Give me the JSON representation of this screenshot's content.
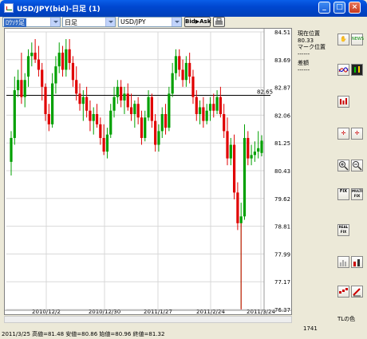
{
  "window": {
    "title": "USD/JPY(bid)-日足 (1)"
  },
  "toolbar": {
    "chart_type": "ﾛｳｿｸ足",
    "period": "日足",
    "symbol": "USD/JPY",
    "bid_ask_label": "Bid▶Ask"
  },
  "info_panel": {
    "current_pos_label": "現在位置",
    "current_pos_value": "80.33",
    "mark_pos_label": "マーク位置",
    "mark_pos_value": "------",
    "diff_label": "差額",
    "diff_value": "------"
  },
  "tools": {
    "news": "NEWS",
    "fix": "FIX",
    "multi_fix": "MULTI FIX",
    "real_fix": "REAL FIX"
  },
  "status": {
    "text": "2011/3/25  高値=81.48 安値=80.86 始値=80.96 終値=81.32",
    "tl_color": "TLの色",
    "count": "1741"
  },
  "colors": {
    "up": "#00a000",
    "down": "#e00000",
    "accent": "#0047d0"
  },
  "chart_data": {
    "type": "candlestick",
    "price_axis": [
      "84.51",
      "83.69",
      "82.87",
      "82.06",
      "81.25",
      "80.43",
      "79.62",
      "78.81",
      "77.99",
      "77.17",
      "76.37"
    ],
    "date_axis": [
      "2010/12/2",
      "2010/12/30",
      "2011/1/27",
      "2011/2/24",
      "2011/3/24"
    ],
    "ylim": [
      76.37,
      84.51
    ],
    "level_line": "82.65",
    "candles": [
      [
        80.7,
        81.6,
        80.3,
        81.4
      ],
      [
        81.4,
        83.2,
        81.2,
        82.8
      ],
      [
        82.8,
        83.4,
        82.6,
        83.1
      ],
      [
        83.1,
        83.9,
        82.4,
        82.6
      ],
      [
        82.6,
        83.3,
        82.3,
        83.1
      ],
      [
        83.2,
        84.0,
        82.9,
        83.8
      ],
      [
        83.8,
        84.2,
        83.5,
        83.9
      ],
      [
        83.9,
        84.3,
        83.6,
        83.7
      ],
      [
        83.7,
        84.1,
        83.2,
        83.4
      ],
      [
        83.4,
        83.6,
        82.5,
        82.9
      ],
      [
        82.9,
        83.0,
        81.9,
        82.1
      ],
      [
        82.1,
        82.4,
        81.6,
        81.8
      ],
      [
        81.8,
        83.3,
        81.7,
        83.0
      ],
      [
        83.0,
        83.8,
        82.7,
        83.5
      ],
      [
        83.5,
        84.2,
        83.3,
        83.9
      ],
      [
        83.9,
        84.1,
        83.2,
        83.4
      ],
      [
        83.4,
        84.3,
        83.2,
        84.0
      ],
      [
        84.0,
        84.3,
        83.4,
        83.6
      ],
      [
        83.6,
        83.8,
        82.9,
        83.1
      ],
      [
        83.1,
        83.5,
        82.5,
        82.7
      ],
      [
        82.7,
        83.0,
        82.2,
        82.4
      ],
      [
        82.4,
        82.8,
        81.9,
        82.6
      ],
      [
        82.6,
        82.9,
        82.0,
        82.2
      ],
      [
        82.2,
        82.5,
        81.6,
        81.9
      ],
      [
        81.9,
        82.3,
        81.5,
        82.1
      ],
      [
        82.1,
        82.4,
        81.7,
        81.8
      ],
      [
        81.8,
        82.0,
        81.2,
        81.4
      ],
      [
        81.4,
        81.8,
        80.9,
        81.0
      ],
      [
        81.0,
        81.7,
        80.8,
        81.5
      ],
      [
        81.5,
        82.4,
        81.4,
        82.2
      ],
      [
        82.2,
        82.9,
        82.0,
        82.6
      ],
      [
        82.6,
        83.1,
        82.4,
        82.9
      ],
      [
        82.9,
        83.1,
        82.3,
        82.5
      ],
      [
        82.5,
        82.9,
        82.1,
        82.7
      ],
      [
        82.7,
        83.0,
        82.2,
        82.3
      ],
      [
        82.3,
        82.7,
        81.9,
        82.1
      ],
      [
        82.1,
        82.5,
        81.7,
        82.4
      ],
      [
        82.4,
        82.6,
        81.8,
        82.0
      ],
      [
        82.0,
        82.2,
        81.2,
        81.4
      ],
      [
        81.4,
        82.2,
        81.3,
        82.0
      ],
      [
        82.0,
        82.8,
        81.9,
        82.6
      ],
      [
        82.6,
        82.7,
        81.7,
        81.9
      ],
      [
        81.9,
        82.1,
        81.0,
        81.2
      ],
      [
        81.2,
        81.8,
        81.0,
        81.6
      ],
      [
        81.6,
        82.3,
        81.4,
        82.1
      ],
      [
        82.1,
        82.4,
        81.5,
        81.7
      ],
      [
        81.7,
        82.9,
        81.6,
        82.7
      ],
      [
        82.7,
        83.6,
        82.6,
        83.3
      ],
      [
        83.3,
        84.0,
        83.1,
        83.8
      ],
      [
        83.8,
        84.0,
        83.2,
        83.4
      ],
      [
        83.4,
        83.7,
        82.9,
        83.1
      ],
      [
        83.1,
        83.8,
        82.9,
        83.6
      ],
      [
        83.6,
        83.9,
        83.0,
        83.2
      ],
      [
        83.2,
        83.4,
        82.4,
        82.6
      ],
      [
        82.6,
        82.8,
        81.9,
        82.1
      ],
      [
        82.1,
        82.5,
        81.8,
        82.3
      ],
      [
        82.3,
        82.6,
        81.7,
        81.9
      ],
      [
        81.9,
        82.4,
        81.8,
        82.2
      ],
      [
        82.2,
        82.6,
        81.9,
        82.4
      ],
      [
        82.4,
        82.7,
        82.0,
        82.2
      ],
      [
        82.2,
        82.8,
        82.1,
        82.6
      ],
      [
        82.6,
        82.9,
        82.0,
        82.1
      ],
      [
        82.1,
        82.4,
        81.4,
        81.6
      ],
      [
        81.6,
        82.0,
        80.6,
        80.8
      ],
      [
        80.8,
        81.4,
        80.6,
        81.2
      ],
      [
        81.2,
        81.5,
        79.6,
        79.8
      ],
      [
        79.8,
        80.1,
        78.7,
        78.9
      ],
      [
        78.9,
        79.5,
        76.4,
        79.1
      ],
      [
        79.1,
        81.8,
        79.0,
        81.4
      ],
      [
        81.4,
        81.6,
        80.6,
        80.8
      ],
      [
        80.8,
        81.2,
        80.6,
        80.9
      ],
      [
        80.9,
        81.3,
        80.7,
        81.0
      ],
      [
        81.0,
        81.6,
        80.8,
        81.1
      ],
      [
        80.96,
        81.48,
        80.86,
        81.32
      ]
    ]
  }
}
